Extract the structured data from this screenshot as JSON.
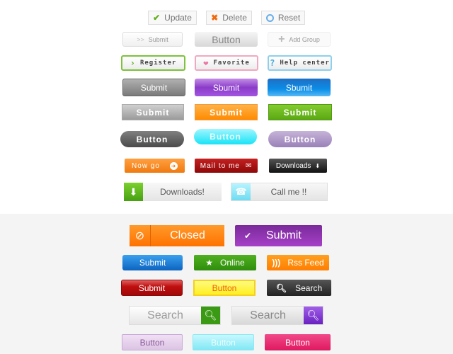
{
  "row1": {
    "update": "Update",
    "delete": "Delete",
    "reset": "Reset"
  },
  "row2": {
    "submit": "Submit",
    "submit_icon": ">>",
    "button": "Button",
    "add_group": "Add Group"
  },
  "row3": {
    "register": "Register",
    "favorite": "Favorite",
    "help": "Help center"
  },
  "row4": {
    "gray": "Submit",
    "purple": "Sbumit",
    "blue": "Sbumit"
  },
  "row5": {
    "gray": "Submit",
    "orange": "Submit",
    "green": "Submit"
  },
  "row6": {
    "dark": "Button",
    "cyan": "Button",
    "lavender": "Button"
  },
  "row7": {
    "now_go": "Now go",
    "mail": "Mail to me",
    "downloads": "Downloads"
  },
  "row8": {
    "downloads": "Downloads!",
    "call": "Call me !!"
  },
  "row9": {
    "closed": "Closed",
    "submit": "Submit"
  },
  "row10": {
    "submit": "Submit",
    "online": "Online",
    "rss": "Rss Feed"
  },
  "row11": {
    "submit": "Submit",
    "button": "Button",
    "search": "Search"
  },
  "row12": {
    "search_green": "Search",
    "search_purple": "Search"
  },
  "row13": {
    "lavender": "Button",
    "cyan": "Button",
    "pink": "Button"
  },
  "colors": {
    "green": "#5fb11c",
    "orange": "#ff7d0a",
    "purple": "#8a2ba5",
    "blue": "#1a7ed6",
    "red": "#b80f0f",
    "pink": "#e8256c",
    "background_bottom": "#f4f4f4"
  }
}
